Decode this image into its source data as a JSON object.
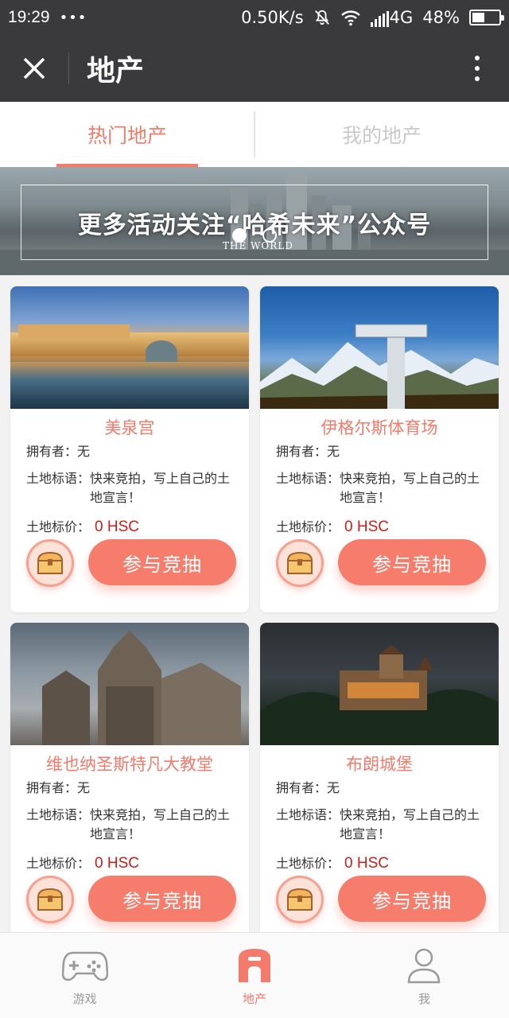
{
  "status_bar": {
    "time": "19:29",
    "dots": "•••",
    "speed": "0.50K/s",
    "network": "4G",
    "battery": "48%",
    "battery_level": 0.48
  },
  "header": {
    "title": "地产"
  },
  "tabs": [
    {
      "label": "热门地产",
      "active": true
    },
    {
      "label": "我的地产",
      "active": false
    }
  ],
  "banner": {
    "text": "更多活动关注“哈希未来”公众号",
    "subtext": "THE WORLD",
    "slides": 2,
    "active_slide": 1
  },
  "cards": [
    {
      "name": "美泉宫",
      "owner_label": "拥有者：",
      "owner": "无",
      "slogan_label": "土地标语：",
      "slogan": "快来竞拍，写上自己的土地宣言！",
      "price_label": "土地标价：",
      "price": "0 HSC",
      "button": "参与竞抽"
    },
    {
      "name": "伊格尔斯体育场",
      "owner_label": "拥有者：",
      "owner": "无",
      "slogan_label": "土地标语：",
      "slogan": "快来竞拍，写上自己的土地宣言！",
      "price_label": "土地标价：",
      "price": "0 HSC",
      "button": "参与竞抽"
    },
    {
      "name": "维也纳圣斯特凡大教堂",
      "owner_label": "拥有者：",
      "owner": "无",
      "slogan_label": "土地标语：",
      "slogan": "快来竞拍，写上自己的土地宣言！",
      "price_label": "土地标价：",
      "price": "0 HSC",
      "button": "参与竞抽"
    },
    {
      "name": "布朗城堡",
      "owner_label": "拥有者：",
      "owner": "无",
      "slogan_label": "土地标语：",
      "slogan": "快来竞拍，写上自己的土地宣言！",
      "price_label": "土地标价：",
      "price": "0 HSC",
      "button": "参与竞抽"
    }
  ],
  "bottom_nav": [
    {
      "label": "游戏",
      "icon": "gamepad-icon",
      "active": false
    },
    {
      "label": "地产",
      "icon": "estate-icon",
      "active": true
    },
    {
      "label": "我",
      "icon": "user-icon",
      "active": false
    }
  ],
  "colors": {
    "accent": "#f37b6b",
    "price": "#c8201a",
    "header_bg": "#3a3a3c"
  }
}
